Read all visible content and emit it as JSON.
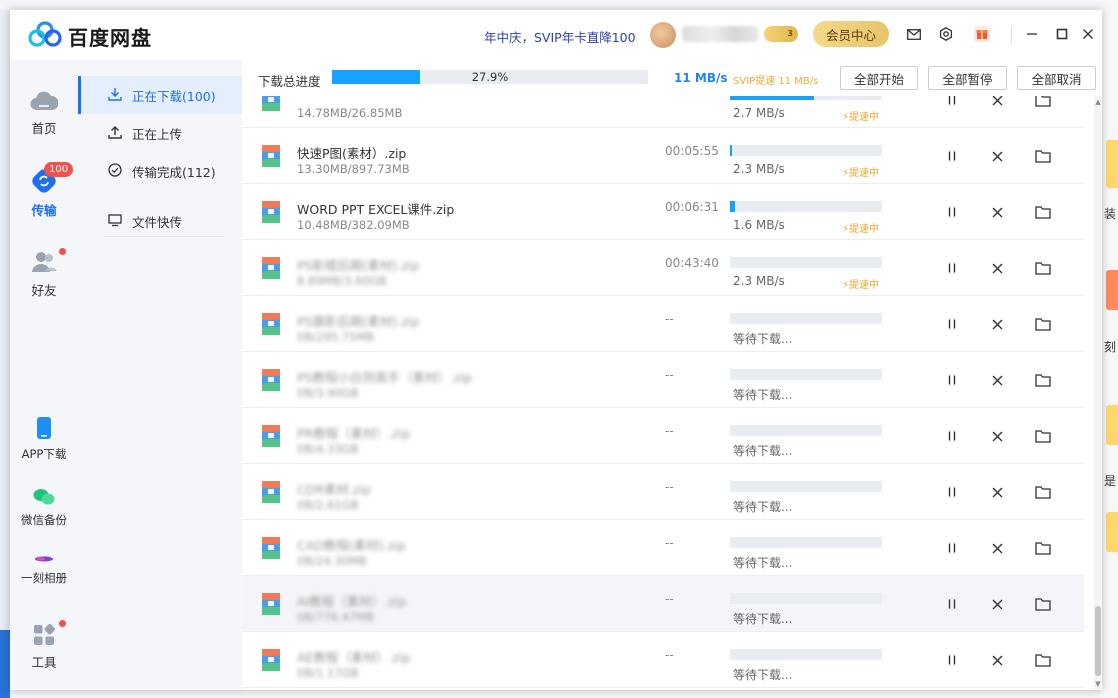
{
  "app": {
    "title": "百度网盘",
    "promo": "年中庆，SVIP年卡直降100",
    "vip_level": "3",
    "member_center": "会员中心"
  },
  "nav": {
    "home": "首页",
    "transfer": "传输",
    "transfer_badge": "100",
    "friends": "好友",
    "app_download": "APP下载",
    "wechat_backup": "微信备份",
    "album": "一刻相册",
    "tools": "工具"
  },
  "subnav": {
    "downloading": "正在下载(100)",
    "uploading": "正在上传",
    "completed": "传输完成(112)",
    "quick_send": "文件快传"
  },
  "toolbar": {
    "total_label": "下载总进度",
    "total_percent": "27.9%",
    "total_progress": 0.279,
    "speed": "11 MB/s",
    "svip_speed": "SVIP提速 11 MB/s",
    "start_all": "全部开始",
    "pause_all": "全部暂停",
    "cancel_all": "全部取消"
  },
  "rows": [
    {
      "name": "",
      "size": "14.78MB/26.85MB",
      "time": "",
      "speed": "2.7 MB/s",
      "boost": "提速中",
      "progress": 0.55,
      "blur": false
    },
    {
      "name": "快速P图(素材）.zip",
      "size": "13.30MB/897.73MB",
      "time": "00:05:55",
      "speed": "2.3 MB/s",
      "boost": "提速中",
      "progress": 0.015,
      "blur": false
    },
    {
      "name": "WORD PPT EXCEL课件.zip",
      "size": "10.48MB/382.09MB",
      "time": "00:06:31",
      "speed": "1.6 MB/s",
      "boost": "提速中",
      "progress": 0.03,
      "blur": false
    },
    {
      "name": "PS影楼后期(素材).zip",
      "size": "8.89MB/3.60GB",
      "time": "00:43:40",
      "speed": "2.3 MB/s",
      "boost": "提速中",
      "progress": 0.0,
      "blur": true
    },
    {
      "name": "PS摄影后期(素材).zip",
      "size": "0B/295.75MB",
      "time": "--",
      "speed": "等待下载...",
      "boost": "",
      "progress": 0,
      "blur": true
    },
    {
      "name": "PS教程小白到高手（素材）.zip",
      "size": "0B/3.90GB",
      "time": "--",
      "speed": "等待下载...",
      "boost": "",
      "progress": 0,
      "blur": true
    },
    {
      "name": "PR教程（素材）.zip",
      "size": "0B/4.33GB",
      "time": "--",
      "speed": "等待下载...",
      "boost": "",
      "progress": 0,
      "blur": true
    },
    {
      "name": "CDR素材.zip",
      "size": "0B/2.61GB",
      "time": "--",
      "speed": "等待下载...",
      "boost": "",
      "progress": 0,
      "blur": true
    },
    {
      "name": "CAD教程(素材).zip",
      "size": "0B/24.30MB",
      "time": "--",
      "speed": "等待下载...",
      "boost": "",
      "progress": 0,
      "blur": true
    },
    {
      "name": "AI教程（素材）.zip",
      "size": "0B/776.47MB",
      "time": "--",
      "speed": "等待下载...",
      "boost": "",
      "progress": 0,
      "blur": true
    },
    {
      "name": "AE教程（素材）.zip",
      "size": "0B/1.17GB",
      "time": "--",
      "speed": "等待下载...",
      "boost": "",
      "progress": 0,
      "blur": true
    }
  ],
  "background": {
    "right_glyphs": [
      "装",
      "刻",
      "是"
    ]
  },
  "icons": {
    "row_file": "zip-archive-icon",
    "pause": "pause-icon",
    "cancel": "close-icon",
    "folder": "folder-icon",
    "boost": "lightning-icon"
  },
  "colors": {
    "accent": "#1e6ef2",
    "progress": "#16a2ff",
    "boost": "#f0a83a",
    "badge": "#f2524c"
  }
}
